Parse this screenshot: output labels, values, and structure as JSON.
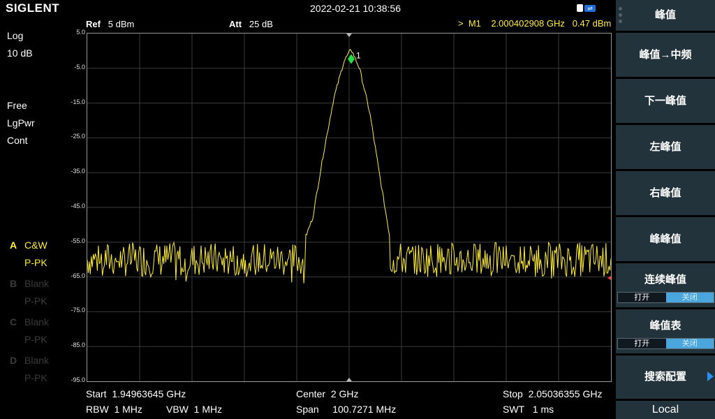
{
  "header": {
    "brand": "SIGLENT",
    "datetime": "2022-02-21 10:38:56"
  },
  "left_panel": {
    "scale_type": "Log",
    "scale_div": "10 dB",
    "trig": "Free",
    "detector": "LgPwr",
    "sweep": "Cont",
    "traces": [
      {
        "letter": "A",
        "mode": "C&W",
        "det": "P-PK",
        "active": true
      },
      {
        "letter": "B",
        "mode": "Blank",
        "det": "P-PK",
        "active": false
      },
      {
        "letter": "C",
        "mode": "Blank",
        "det": "P-PK",
        "active": false
      },
      {
        "letter": "D",
        "mode": "Blank",
        "det": "P-PK",
        "active": false
      }
    ]
  },
  "readout": {
    "ref_label": "Ref",
    "ref_value": "5 dBm",
    "att_label": "Att",
    "att_value": "25 dB",
    "marker_prefix": ">",
    "marker_name": "M1",
    "marker_freq": "2.000402908 GHz",
    "marker_amp": "0.47 dBm",
    "marker_tag": "1"
  },
  "y_ticks": [
    "5.0",
    "-5.0",
    "-15.0",
    "-25.0",
    "-35.0",
    "-45.0",
    "-55.0",
    "-65.0",
    "-75.0",
    "-85.0",
    "-95.0"
  ],
  "footer": {
    "start_label": "Start",
    "start_value": "1.94963645 GHz",
    "center_label": "Center",
    "center_value": "2 GHz",
    "stop_label": "Stop",
    "stop_value": "2.05036355 GHz",
    "rbw_label": "RBW",
    "rbw_value": "1 MHz",
    "vbw_label": "VBW",
    "vbw_value": "1 MHz",
    "span_label": "Span",
    "span_value": "100.7271 MHz",
    "swt_label": "SWT",
    "swt_value": "1 ms"
  },
  "menu": {
    "title": "峰值",
    "peak_to_center": "峰值→中频",
    "next_peak": "下一峰值",
    "left_peak": "左峰值",
    "right_peak": "右峰值",
    "peak_peak": "峰峰值",
    "continuous_peak": "连续峰值",
    "peak_table": "峰值表",
    "toggle_on": "打开",
    "toggle_off": "关闭",
    "search_config": "搜索配置",
    "local": "Local"
  },
  "colors": {
    "trace": "#ffee33",
    "marker": "#22dd44",
    "menu_bg": "#23333b",
    "toggle_selected": "#4aa6dc"
  },
  "chart_data": {
    "type": "line",
    "ylabel": "",
    "xlabel": "",
    "ylim": [
      -95,
      5
    ],
    "y_unit": "dBm",
    "xlim_ghz": [
      1.94963645,
      2.05036355
    ],
    "grid": true,
    "noise_floor_dbm": [
      -65,
      -55
    ],
    "peak": {
      "x_ghz": 2.000402908,
      "y_dbm": 0.47
    },
    "series": [
      {
        "values": [
          [
            1.9496,
            -60
          ],
          [
            1.953,
            -61
          ],
          [
            1.957,
            -59
          ],
          [
            1.961,
            -62
          ],
          [
            1.965,
            -60
          ],
          [
            1.969,
            -59
          ],
          [
            1.973,
            -61
          ],
          [
            1.977,
            -60
          ],
          [
            1.981,
            -62
          ],
          [
            1.985,
            -59
          ],
          [
            1.989,
            -60
          ],
          [
            1.991,
            -56
          ],
          [
            1.993,
            -48
          ],
          [
            1.995,
            -30
          ],
          [
            1.997,
            -14
          ],
          [
            1.999,
            -3
          ],
          [
            2.0004,
            0.47
          ],
          [
            2.002,
            -5
          ],
          [
            2.004,
            -18
          ],
          [
            2.006,
            -37
          ],
          [
            2.008,
            -55
          ],
          [
            2.01,
            -60
          ],
          [
            2.014,
            -61
          ],
          [
            2.018,
            -59
          ],
          [
            2.022,
            -62
          ],
          [
            2.026,
            -60
          ],
          [
            2.03,
            -59
          ],
          [
            2.034,
            -61
          ],
          [
            2.038,
            -60
          ],
          [
            2.042,
            -62
          ],
          [
            2.046,
            -60
          ],
          [
            2.0504,
            -61
          ]
        ]
      }
    ]
  }
}
